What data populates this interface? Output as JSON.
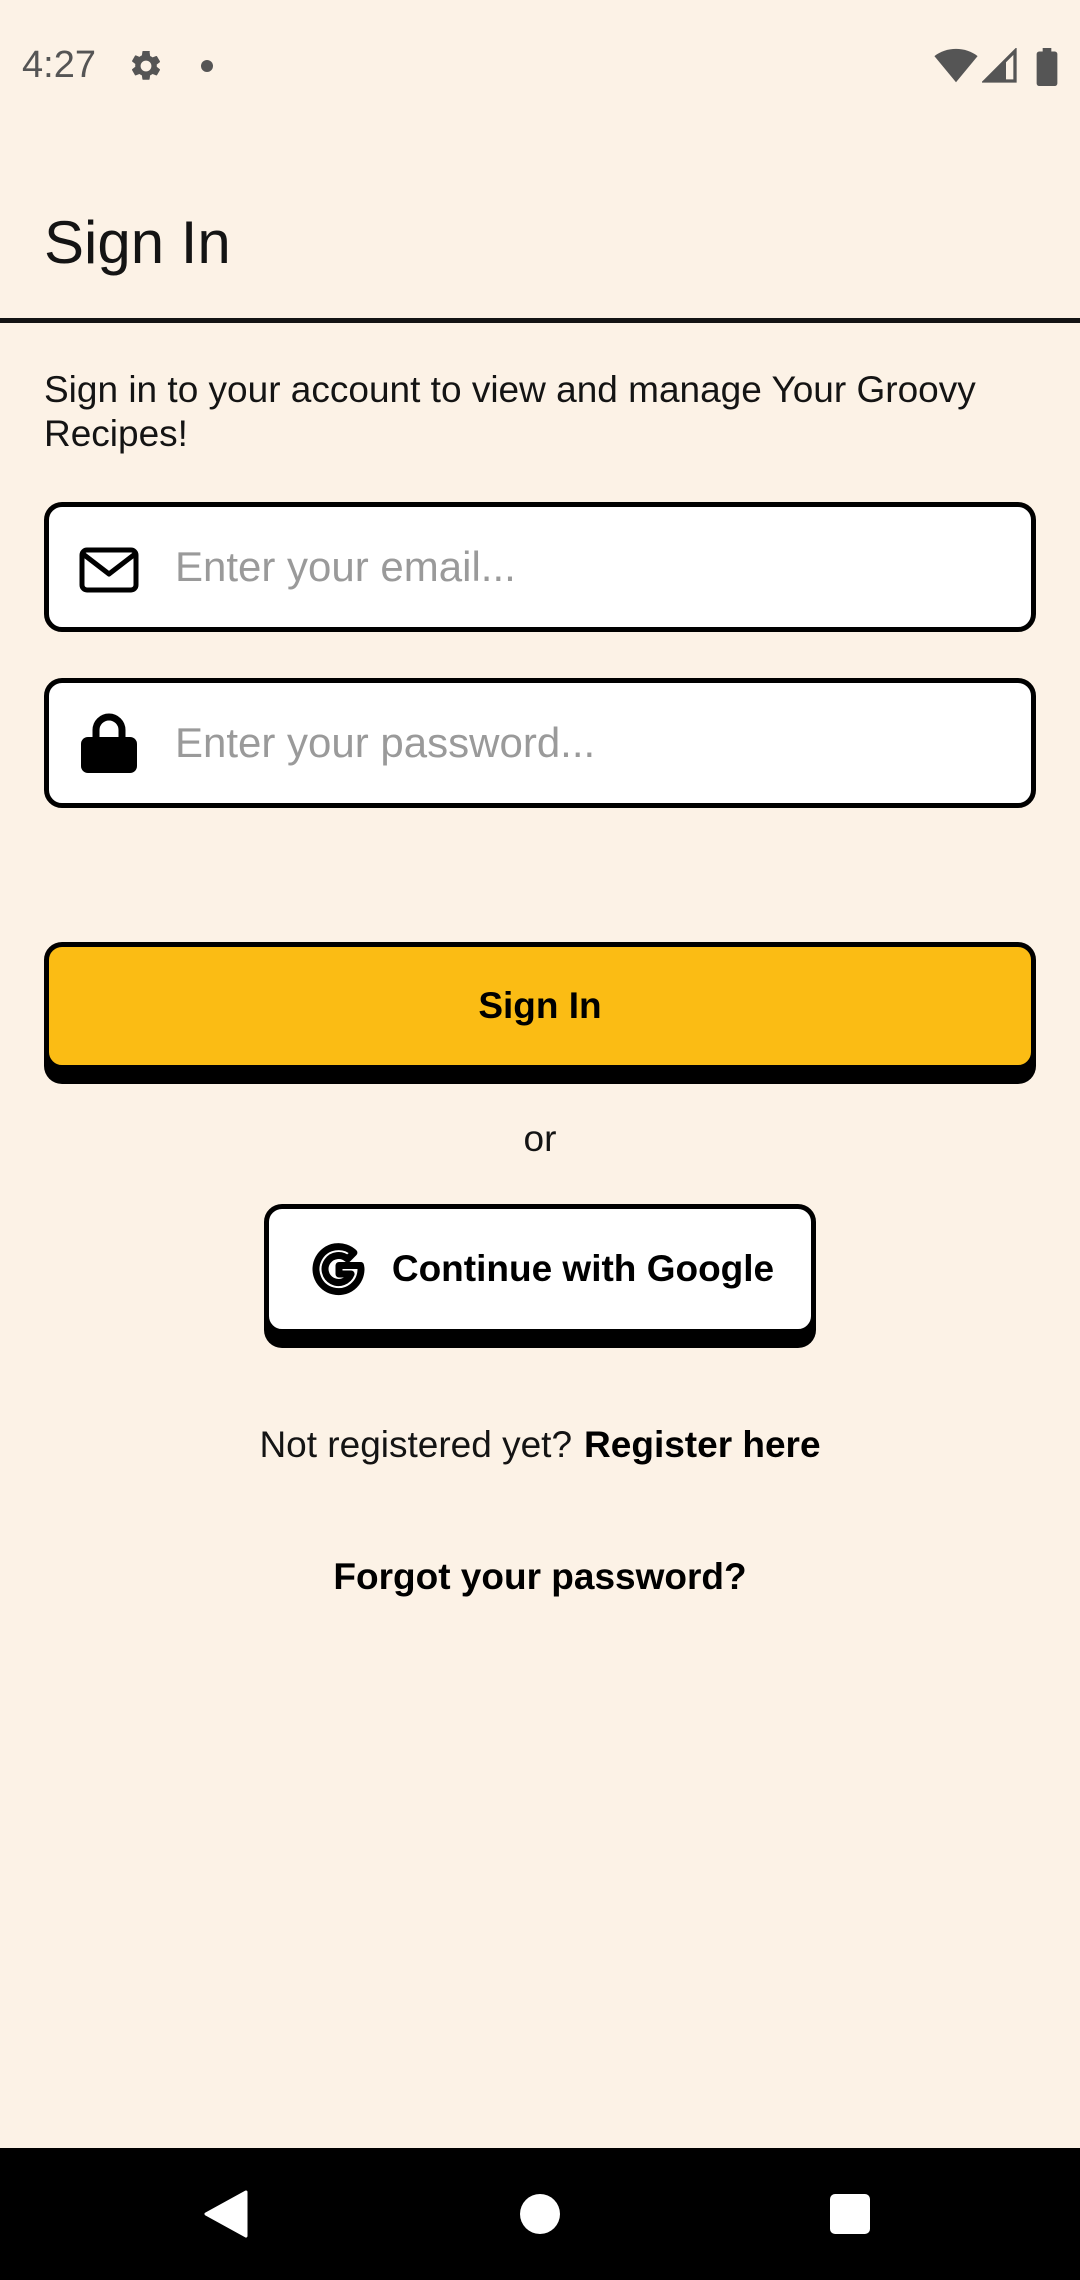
{
  "status_bar": {
    "time": "4:27"
  },
  "header": {
    "title": "Sign In"
  },
  "form": {
    "subtitle": "Sign in to your account to view and manage Your Groovy Recipes!",
    "email": {
      "placeholder": "Enter your email...",
      "value": ""
    },
    "password": {
      "placeholder": "Enter your password...",
      "value": ""
    },
    "sign_in_label": "Sign In",
    "or_label": "or",
    "google_label": "Continue with Google",
    "register_prompt": "Not registered yet?",
    "register_link": "Register here",
    "forgot_link": "Forgot your password?"
  },
  "colors": {
    "background": "#fcf2e6",
    "primary_button": "#fbbc14",
    "border": "#000000"
  },
  "icons": {
    "email": "envelope-icon",
    "password": "lock-icon",
    "google": "google-icon",
    "settings": "gear-icon"
  }
}
